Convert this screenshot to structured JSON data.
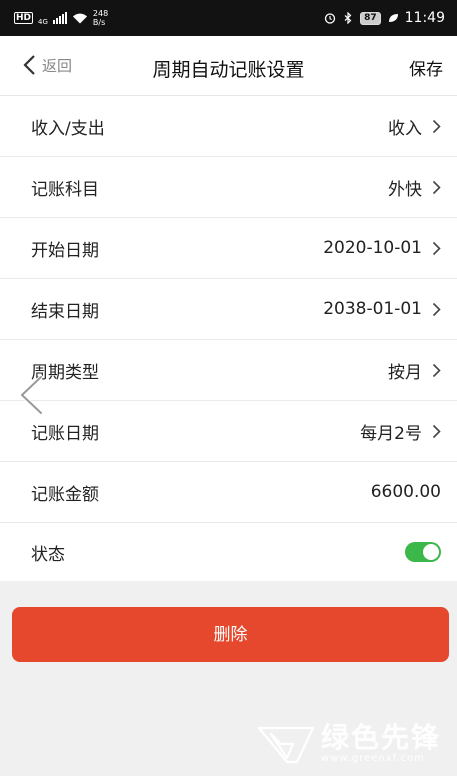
{
  "status_bar": {
    "hd": "HD",
    "network": "4G",
    "speed_value": "248",
    "speed_unit": "B/s",
    "battery": "87",
    "time": "11:49"
  },
  "header": {
    "back_label": "返回",
    "title": "周期自动记账设置",
    "save_label": "保存"
  },
  "rows": [
    {
      "label": "收入/支出",
      "value": "收入"
    },
    {
      "label": "记账科目",
      "value": "外快"
    },
    {
      "label": "开始日期",
      "value": "2020-10-01"
    },
    {
      "label": "结束日期",
      "value": "2038-01-01"
    },
    {
      "label": "周期类型",
      "value": "按月"
    },
    {
      "label": "记账日期",
      "value": "每月2号"
    },
    {
      "label": "记账金额",
      "value": "6600.00"
    },
    {
      "label": "状态",
      "toggle_on": true
    }
  ],
  "delete_label": "删除",
  "watermark": {
    "cn": "绿色先锋",
    "url": "www.greenxf.com"
  },
  "colors": {
    "delete": "#e5482c",
    "toggle_on": "#3cb84b",
    "background": "#f1f0f0"
  }
}
